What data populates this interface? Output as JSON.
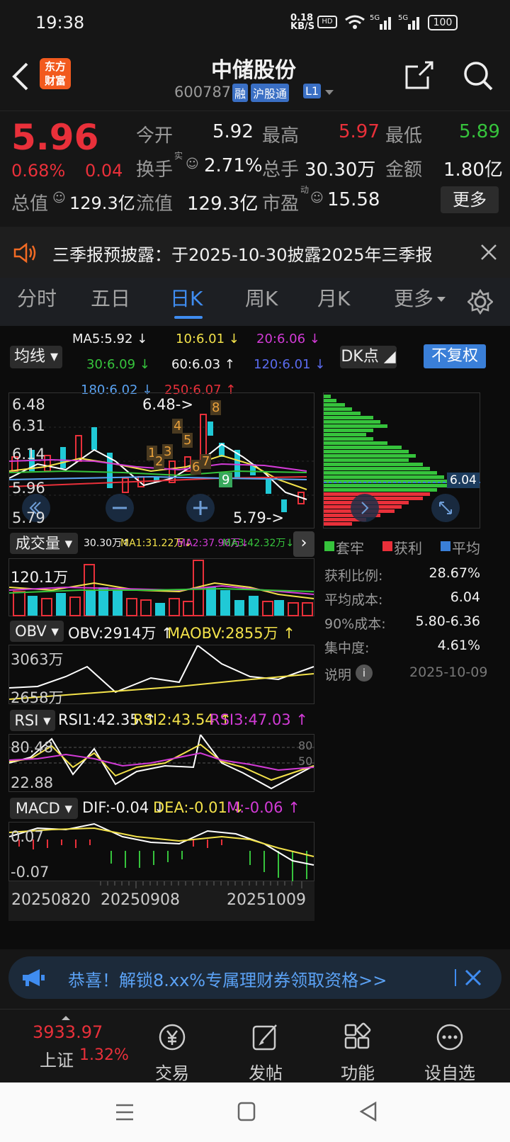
{
  "status_bar": {
    "time": "19:38",
    "net_speed": "0.18",
    "net_unit": "KB/S",
    "battery": "100"
  },
  "header": {
    "logo_line1": "东方",
    "logo_line2": "财富",
    "title": "中储股份",
    "code": "600787",
    "badge_rong": "融",
    "badge_hgt": "沪股通",
    "badge_l1": "L1"
  },
  "quote": {
    "price": "5.96",
    "change_pct": "0.68%",
    "change": "0.04",
    "open_label": "今开",
    "open": "5.92",
    "high_label": "最高",
    "high": "5.97",
    "low_label": "最低",
    "low": "5.89",
    "turnover_label": "换手",
    "turnover_sup": "实",
    "turnover": "2.71%",
    "volume_label": "总手",
    "volume": "30.30万",
    "amount_label": "金额",
    "amount": "1.80亿",
    "mktcap_label": "总值",
    "mktcap": "129.3亿",
    "float_label": "流值",
    "float_cap": "129.3亿",
    "pe_label": "市盈",
    "pe_sup": "动",
    "pe": "15.58",
    "more": "更多"
  },
  "notice": {
    "text": "三季报预披露：于2025-10-30披露2025年三季报"
  },
  "tabs": [
    "分时",
    "五日",
    "日K",
    "周K",
    "月K",
    "更多"
  ],
  "active_tab": "日K",
  "ma_legend": {
    "ma5": "MA5:5.92",
    "ma10": "10:6.01",
    "ma20": "20:6.06",
    "ma30": "30:6.09",
    "ma60": "60:6.03",
    "ma120": "120:6.01",
    "ma180": "180:6.02",
    "ma250": "250:6.07",
    "selector": "均线",
    "dk": "DK点",
    "fq": "不复权"
  },
  "kline": {
    "y_labels": [
      "6.48",
      "6.31",
      "6.14",
      "5.96",
      "5.79"
    ],
    "high_marker": "6.48->",
    "low_marker": "5.79->",
    "nine_turn": [
      "1",
      "2",
      "3",
      "4",
      "5",
      "6",
      "7",
      "8",
      "9"
    ],
    "chip_price": "6.04"
  },
  "volume": {
    "selector": "成交量",
    "vol": "30.30万",
    "ma1": "MA1:31.22万",
    "ma2": "MA2:37.96万",
    "ma3": "MA3:42.32万",
    "y_label": "120.1万"
  },
  "obv": {
    "selector": "OBV",
    "obv": "OBV:2914万",
    "maobv": "MAOBV:2855万",
    "y_top": "3063万",
    "y_bottom": "2658万"
  },
  "rsi": {
    "selector": "RSI",
    "rsi1": "RSI1:42.35",
    "rsi2": "RSI2:43.54",
    "rsi3": "RSI3:47.03",
    "y_top": "80.48",
    "y_bottom": "22.88",
    "ref80": "80",
    "ref50": "50"
  },
  "macd": {
    "selector": "MACD",
    "dif": "DIF:-0.04",
    "dea": "DEA:-0.01",
    "m": "M:-0.06",
    "y_top": "0.07",
    "y_bottom": "-0.07"
  },
  "dates": [
    "20250820",
    "20250908",
    "20251009"
  ],
  "chips": {
    "legend_trapped": "套牢",
    "legend_profit": "获利",
    "legend_avg": "平均",
    "rows": [
      {
        "label": "获利比例:",
        "value": "28.67%"
      },
      {
        "label": "平均成本:",
        "value": "6.04"
      },
      {
        "label": "90%成本:",
        "value": "5.80-6.36"
      },
      {
        "label": "集中度:",
        "value": "4.61%"
      }
    ],
    "note_label": "说明",
    "note_date": "2025-10-09"
  },
  "promo": {
    "text": "恭喜！解锁8.xx%专属理财券领取资格>>"
  },
  "bottom_nav": {
    "index_value": "3933.97",
    "index_name": "上证",
    "index_change": "1.32%",
    "items": [
      "交易",
      "发帖",
      "功能",
      "设自选"
    ]
  },
  "colors": {
    "up": "#e9303a",
    "down": "#36c33c",
    "accent": "#3f8cf0",
    "ma5": "#ffffff",
    "ma10": "#f3e24a",
    "ma20": "#d23bd6"
  }
}
